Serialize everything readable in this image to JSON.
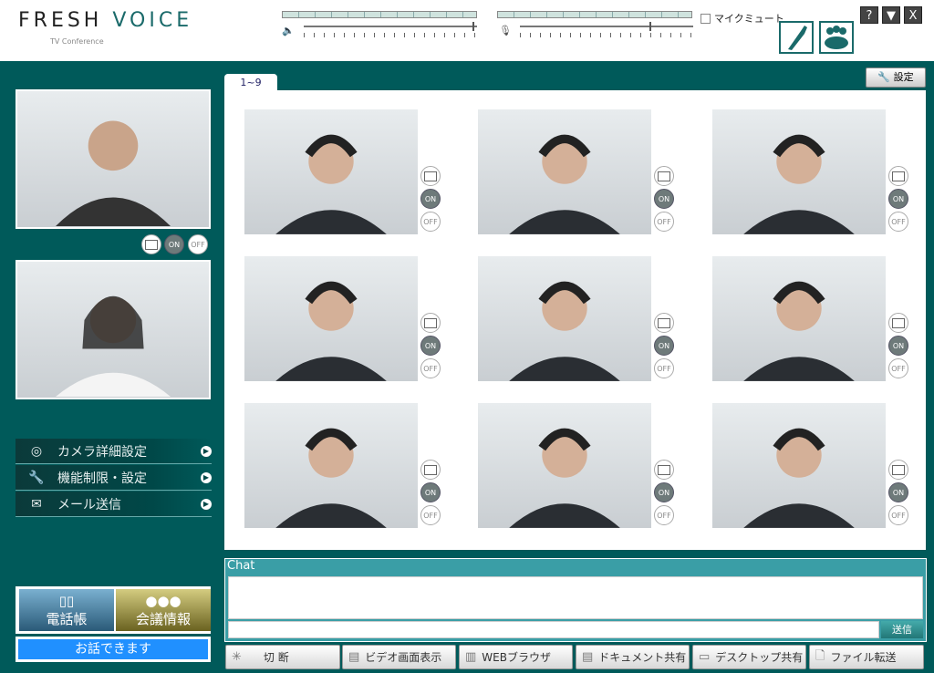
{
  "app": {
    "logo_fresh": "FRESH",
    "logo_voice": "VOICE",
    "logo_sub": "TV Conference"
  },
  "audio": {
    "speaker_level": 1.0,
    "mic_level": 0.78,
    "mic_mute_label": "マイクミュート",
    "mic_mute_checked": false
  },
  "window_buttons": {
    "help": "?",
    "minimize": "▼",
    "close": "X"
  },
  "tab": {
    "label": "1~9"
  },
  "settings_label": "設定",
  "tile_controls": {
    "on": "ON",
    "off": "OFF"
  },
  "participants": 9,
  "menu": [
    {
      "icon": "camera-icon",
      "label": "カメラ詳細設定"
    },
    {
      "icon": "wrench-icon",
      "label": "機能制限・設定"
    },
    {
      "icon": "mail-icon",
      "label": "メール送信"
    }
  ],
  "phonebook_label": "電話帳",
  "meeting_info_label": "会議情報",
  "status_text": "お話できます",
  "chat": {
    "title": "Chat",
    "input_value": "",
    "send_label": "送信"
  },
  "bottom_buttons": [
    {
      "icon": "disconnect-icon",
      "label": "切 断"
    },
    {
      "icon": "film-icon",
      "label": "ビデオ画面表示"
    },
    {
      "icon": "browser-icon",
      "label": "WEBブラウザ"
    },
    {
      "icon": "document-icon",
      "label": "ドキュメント共有"
    },
    {
      "icon": "monitor-icon",
      "label": "デスクトップ共有"
    },
    {
      "icon": "file-transfer-icon",
      "label": "ファイル転送"
    }
  ],
  "colors": {
    "teal": "#005a5a",
    "chat": "#3a9ea6",
    "status": "#2090ff"
  }
}
